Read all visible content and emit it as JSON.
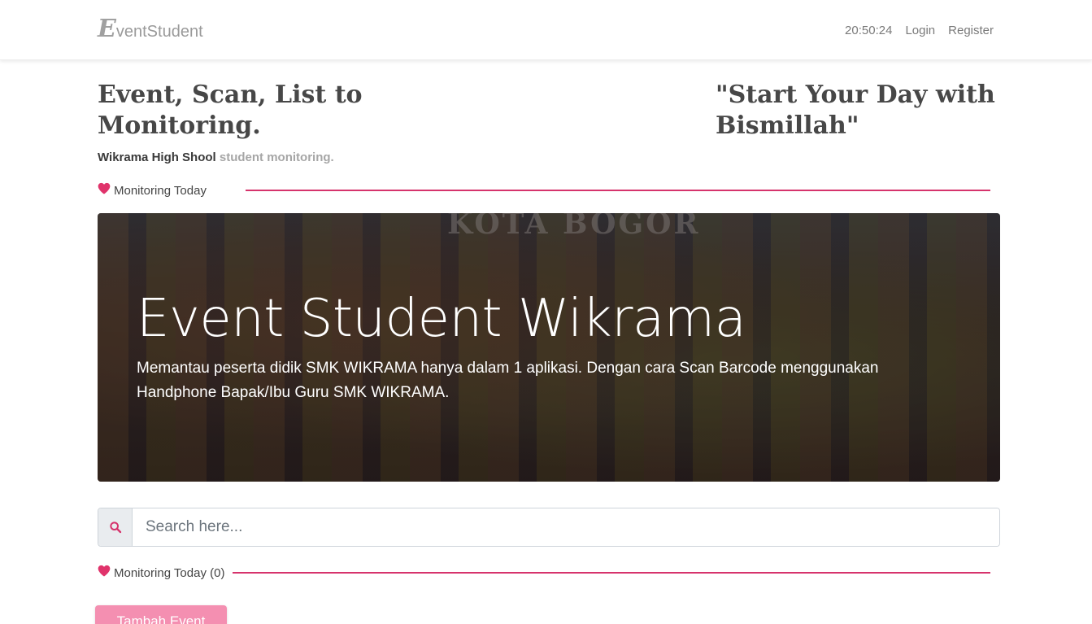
{
  "navbar": {
    "brand_initial": "E",
    "brand_rest": "ventStudent",
    "clock": "20:50:24",
    "login": "Login",
    "register": "Register"
  },
  "header": {
    "left_title": "Event, Scan, List to Monitoring.",
    "right_title": "\"Start Your Day with Bismillah\"",
    "subline_bold": "Wikrama High Shool",
    "subline_muted": "student monitoring."
  },
  "sections": {
    "monitoring_today": "Monitoring Today",
    "monitoring_today_count": "Monitoring Today (0)"
  },
  "hero": {
    "wall_sign": "KOTA BOGOR",
    "title": "Event Student Wikrama",
    "text": "Memantau peserta didik SMK WIKRAMA hanya dalam 1 aplikasi. Dengan cara Scan Barcode menggunakan Handphone Bapak/Ibu Guru SMK WIKRAMA."
  },
  "search": {
    "placeholder": "Search here...",
    "value": ""
  },
  "actions": {
    "add_event": "Tambah Event"
  },
  "icons": {
    "section": "heart-icon",
    "search": "search-icon"
  },
  "colors": {
    "accent": "#d6336c",
    "heart": "#e0336b",
    "button": "#f48fb1"
  }
}
